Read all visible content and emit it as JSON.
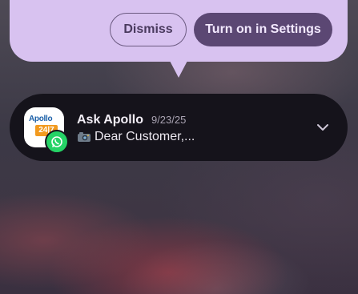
{
  "prompt": {
    "dismiss_label": "Dismiss",
    "settings_label": "Turn on in Settings"
  },
  "notification": {
    "app_name": "Ask Apollo",
    "time": "9/23/25",
    "message": "Dear Customer,...",
    "app_icon": {
      "logo_text_top": "Apollo",
      "logo_text_bottom": "24|7",
      "name": "apollo-247-app-icon"
    },
    "badge_icon": "whatsapp-icon",
    "message_icon": "camera-icon",
    "expand_icon": "chevron-down-icon"
  },
  "colors": {
    "bubble": "#d8c2f0",
    "primary_button": "#5b4773",
    "card": "#15131b",
    "whatsapp_green": "#25d366",
    "apollo_blue": "#1a5fa8",
    "apollo_orange": "#f29a1f"
  }
}
